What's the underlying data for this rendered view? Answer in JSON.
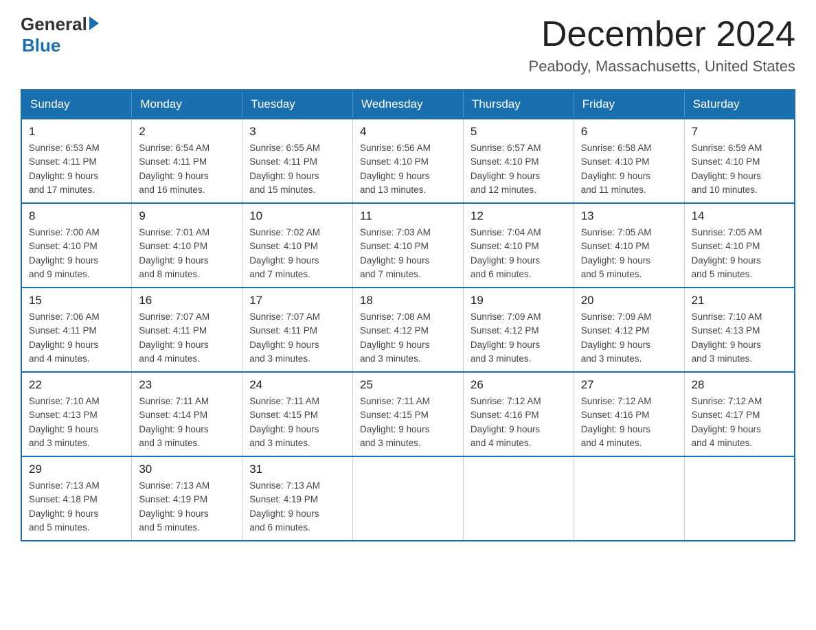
{
  "logo": {
    "general": "General",
    "blue": "Blue"
  },
  "title": "December 2024",
  "location": "Peabody, Massachusetts, United States",
  "days_of_week": [
    "Sunday",
    "Monday",
    "Tuesday",
    "Wednesday",
    "Thursday",
    "Friday",
    "Saturday"
  ],
  "weeks": [
    [
      {
        "day": "1",
        "sunrise": "6:53 AM",
        "sunset": "4:11 PM",
        "daylight": "9 hours and 17 minutes."
      },
      {
        "day": "2",
        "sunrise": "6:54 AM",
        "sunset": "4:11 PM",
        "daylight": "9 hours and 16 minutes."
      },
      {
        "day": "3",
        "sunrise": "6:55 AM",
        "sunset": "4:11 PM",
        "daylight": "9 hours and 15 minutes."
      },
      {
        "day": "4",
        "sunrise": "6:56 AM",
        "sunset": "4:10 PM",
        "daylight": "9 hours and 13 minutes."
      },
      {
        "day": "5",
        "sunrise": "6:57 AM",
        "sunset": "4:10 PM",
        "daylight": "9 hours and 12 minutes."
      },
      {
        "day": "6",
        "sunrise": "6:58 AM",
        "sunset": "4:10 PM",
        "daylight": "9 hours and 11 minutes."
      },
      {
        "day": "7",
        "sunrise": "6:59 AM",
        "sunset": "4:10 PM",
        "daylight": "9 hours and 10 minutes."
      }
    ],
    [
      {
        "day": "8",
        "sunrise": "7:00 AM",
        "sunset": "4:10 PM",
        "daylight": "9 hours and 9 minutes."
      },
      {
        "day": "9",
        "sunrise": "7:01 AM",
        "sunset": "4:10 PM",
        "daylight": "9 hours and 8 minutes."
      },
      {
        "day": "10",
        "sunrise": "7:02 AM",
        "sunset": "4:10 PM",
        "daylight": "9 hours and 7 minutes."
      },
      {
        "day": "11",
        "sunrise": "7:03 AM",
        "sunset": "4:10 PM",
        "daylight": "9 hours and 7 minutes."
      },
      {
        "day": "12",
        "sunrise": "7:04 AM",
        "sunset": "4:10 PM",
        "daylight": "9 hours and 6 minutes."
      },
      {
        "day": "13",
        "sunrise": "7:05 AM",
        "sunset": "4:10 PM",
        "daylight": "9 hours and 5 minutes."
      },
      {
        "day": "14",
        "sunrise": "7:05 AM",
        "sunset": "4:10 PM",
        "daylight": "9 hours and 5 minutes."
      }
    ],
    [
      {
        "day": "15",
        "sunrise": "7:06 AM",
        "sunset": "4:11 PM",
        "daylight": "9 hours and 4 minutes."
      },
      {
        "day": "16",
        "sunrise": "7:07 AM",
        "sunset": "4:11 PM",
        "daylight": "9 hours and 4 minutes."
      },
      {
        "day": "17",
        "sunrise": "7:07 AM",
        "sunset": "4:11 PM",
        "daylight": "9 hours and 3 minutes."
      },
      {
        "day": "18",
        "sunrise": "7:08 AM",
        "sunset": "4:12 PM",
        "daylight": "9 hours and 3 minutes."
      },
      {
        "day": "19",
        "sunrise": "7:09 AM",
        "sunset": "4:12 PM",
        "daylight": "9 hours and 3 minutes."
      },
      {
        "day": "20",
        "sunrise": "7:09 AM",
        "sunset": "4:12 PM",
        "daylight": "9 hours and 3 minutes."
      },
      {
        "day": "21",
        "sunrise": "7:10 AM",
        "sunset": "4:13 PM",
        "daylight": "9 hours and 3 minutes."
      }
    ],
    [
      {
        "day": "22",
        "sunrise": "7:10 AM",
        "sunset": "4:13 PM",
        "daylight": "9 hours and 3 minutes."
      },
      {
        "day": "23",
        "sunrise": "7:11 AM",
        "sunset": "4:14 PM",
        "daylight": "9 hours and 3 minutes."
      },
      {
        "day": "24",
        "sunrise": "7:11 AM",
        "sunset": "4:15 PM",
        "daylight": "9 hours and 3 minutes."
      },
      {
        "day": "25",
        "sunrise": "7:11 AM",
        "sunset": "4:15 PM",
        "daylight": "9 hours and 3 minutes."
      },
      {
        "day": "26",
        "sunrise": "7:12 AM",
        "sunset": "4:16 PM",
        "daylight": "9 hours and 4 minutes."
      },
      {
        "day": "27",
        "sunrise": "7:12 AM",
        "sunset": "4:16 PM",
        "daylight": "9 hours and 4 minutes."
      },
      {
        "day": "28",
        "sunrise": "7:12 AM",
        "sunset": "4:17 PM",
        "daylight": "9 hours and 4 minutes."
      }
    ],
    [
      {
        "day": "29",
        "sunrise": "7:13 AM",
        "sunset": "4:18 PM",
        "daylight": "9 hours and 5 minutes."
      },
      {
        "day": "30",
        "sunrise": "7:13 AM",
        "sunset": "4:19 PM",
        "daylight": "9 hours and 5 minutes."
      },
      {
        "day": "31",
        "sunrise": "7:13 AM",
        "sunset": "4:19 PM",
        "daylight": "9 hours and 6 minutes."
      },
      null,
      null,
      null,
      null
    ]
  ],
  "labels": {
    "sunrise": "Sunrise:",
    "sunset": "Sunset:",
    "daylight": "Daylight:"
  },
  "colors": {
    "header_bg": "#1a6faf",
    "border": "#1a6faf",
    "text_dark": "#222",
    "text_medium": "#444"
  }
}
